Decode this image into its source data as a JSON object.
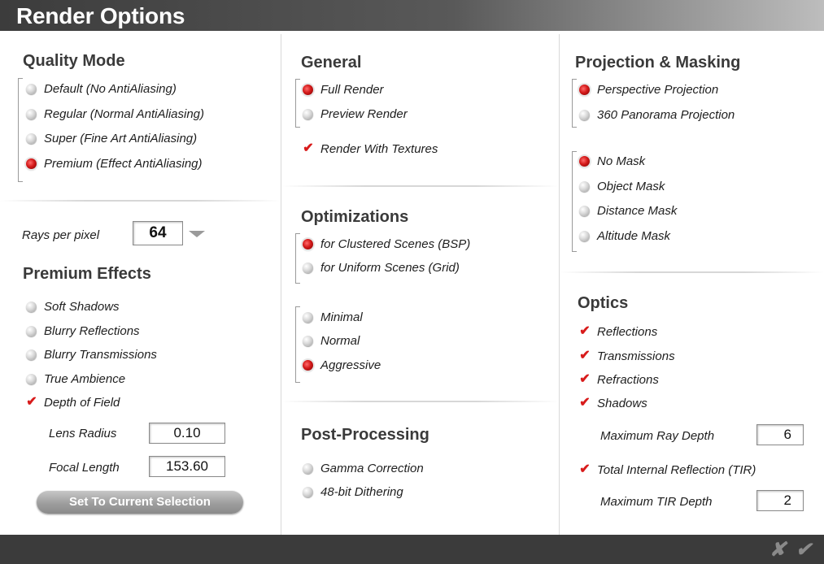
{
  "window": {
    "title": "Render Options"
  },
  "quality_mode": {
    "heading": "Quality Mode",
    "options": [
      {
        "label": "Default (No AntiAliasing)",
        "selected": false
      },
      {
        "label": "Regular (Normal AntiAliasing)",
        "selected": false
      },
      {
        "label": "Super (Fine Art AntiAliasing)",
        "selected": false
      },
      {
        "label": "Premium (Effect AntiAliasing)",
        "selected": true
      }
    ]
  },
  "rays": {
    "label": "Rays per pixel",
    "value": "64"
  },
  "premium_effects": {
    "heading": "Premium Effects",
    "options": [
      {
        "label": "Soft Shadows",
        "checked": false
      },
      {
        "label": "Blurry Reflections",
        "checked": false
      },
      {
        "label": "Blurry Transmissions",
        "checked": false
      },
      {
        "label": "True Ambience",
        "checked": false
      },
      {
        "label": "Depth of Field",
        "checked": true
      }
    ],
    "lens_radius": {
      "label": "Lens Radius",
      "value": "0.10"
    },
    "focal_length": {
      "label": "Focal Length",
      "value": "153.60"
    },
    "set_button": "Set To Current Selection"
  },
  "general": {
    "heading": "General",
    "options": [
      {
        "label": "Full Render",
        "selected": true
      },
      {
        "label": "Preview Render",
        "selected": false
      }
    ],
    "textures": {
      "label": "Render With Textures",
      "checked": true
    }
  },
  "optimizations": {
    "heading": "Optimizations",
    "scene_options": [
      {
        "label": "for Clustered Scenes (BSP)",
        "selected": true
      },
      {
        "label": "for Uniform Scenes (Grid)",
        "selected": false
      }
    ],
    "level_options": [
      {
        "label": "Minimal",
        "selected": false
      },
      {
        "label": "Normal",
        "selected": false
      },
      {
        "label": "Aggressive",
        "selected": true
      }
    ]
  },
  "post_processing": {
    "heading": "Post-Processing",
    "options": [
      {
        "label": "Gamma Correction",
        "selected": false
      },
      {
        "label": "48-bit Dithering",
        "selected": false
      }
    ]
  },
  "projection": {
    "heading": "Projection & Masking",
    "projection_options": [
      {
        "label": "Perspective Projection",
        "selected": true
      },
      {
        "label": "360  Panorama Projection",
        "selected": false
      }
    ],
    "mask_options": [
      {
        "label": "No Mask",
        "selected": true
      },
      {
        "label": "Object Mask",
        "selected": false
      },
      {
        "label": "Distance Mask",
        "selected": false
      },
      {
        "label": "Altitude Mask",
        "selected": false
      }
    ]
  },
  "optics": {
    "heading": "Optics",
    "options": [
      {
        "label": "Reflections",
        "checked": true
      },
      {
        "label": "Transmissions",
        "checked": true
      },
      {
        "label": "Refractions",
        "checked": true
      },
      {
        "label": "Shadows",
        "checked": true
      }
    ],
    "max_ray_depth": {
      "label": "Maximum Ray Depth",
      "value": "6"
    },
    "tir": {
      "label": "Total Internal Reflection (TIR)",
      "checked": true
    },
    "max_tir_depth": {
      "label": "Maximum TIR Depth",
      "value": "2"
    }
  },
  "footer": {
    "cancel_glyph": "✘",
    "ok_glyph": "✔"
  },
  "colors": {
    "accent": "#d41a1a",
    "title_bar": "#3c3c3c",
    "footer": "#3b3b3b"
  }
}
